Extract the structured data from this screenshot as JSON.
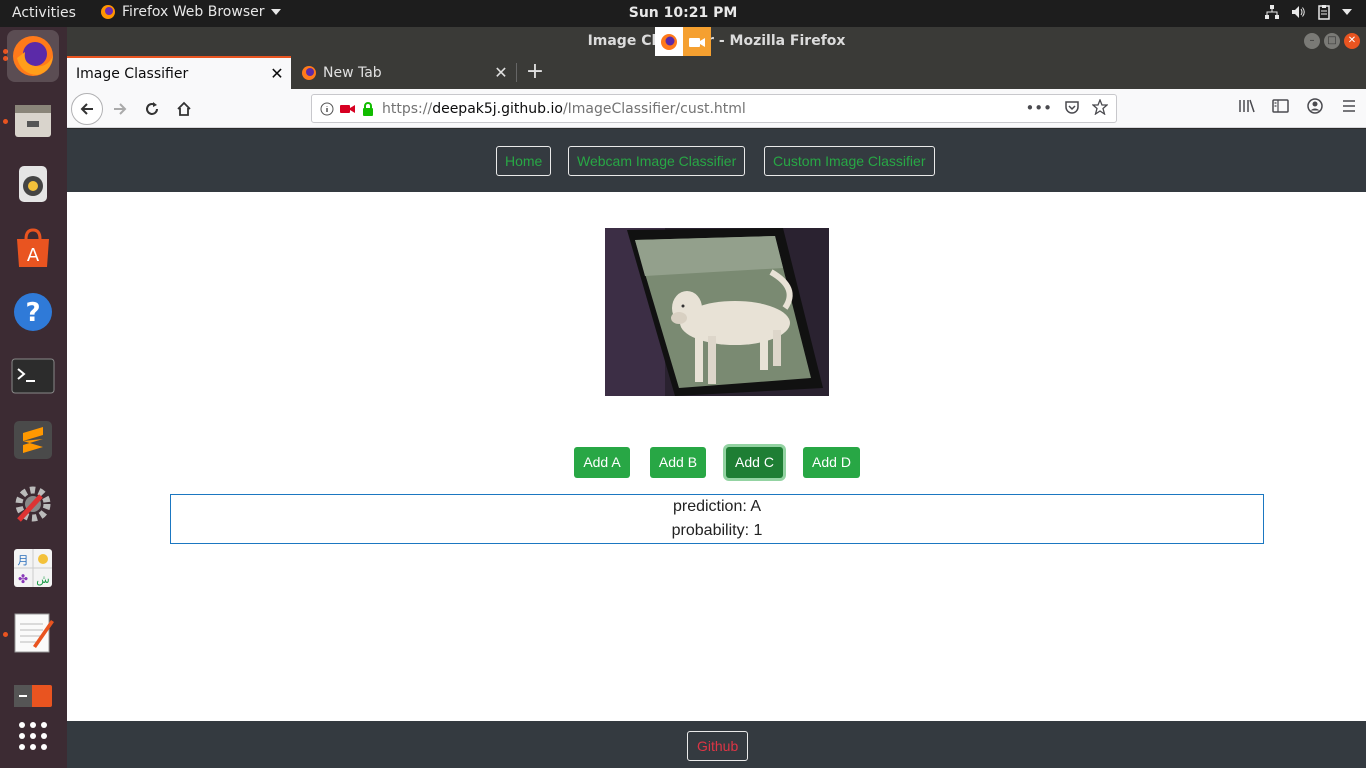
{
  "topbar": {
    "activities": "Activities",
    "app_menu": "Firefox Web Browser",
    "clock": "Sun 10:21 PM"
  },
  "window": {
    "title": "Image Classifier - Mozilla Firefox"
  },
  "tabs": [
    {
      "label": "Image Classifier",
      "active": true
    },
    {
      "label": "New Tab",
      "active": false
    }
  ],
  "navbar": {
    "url_prefix": "https://",
    "url_domain": "deepak5j.github.io",
    "url_path": "/ImageClassifier/cust.html"
  },
  "site": {
    "nav_links": [
      "Home",
      "Webcam Image Classifier",
      "Custom Image Classifier"
    ],
    "buttons": [
      "Add A",
      "Add B",
      "Add C",
      "Add D"
    ],
    "prediction_text": "prediction: A",
    "probability_text": "probability: 1",
    "footer_link": "Github"
  },
  "dock": {
    "items": [
      "firefox-icon",
      "files-icon",
      "rhythmbox-icon",
      "software-icon",
      "help-icon",
      "terminal-icon",
      "sublime-icon",
      "settings-icon",
      "character-map-icon",
      "text-editor-icon",
      "removable-drive-icon",
      "show-apps-icon"
    ]
  },
  "colors": {
    "accent": "#e95420",
    "site_nav_bg": "#343a40",
    "link_green": "#28a745",
    "link_red": "#dc3545",
    "result_border": "#1b77c1"
  }
}
